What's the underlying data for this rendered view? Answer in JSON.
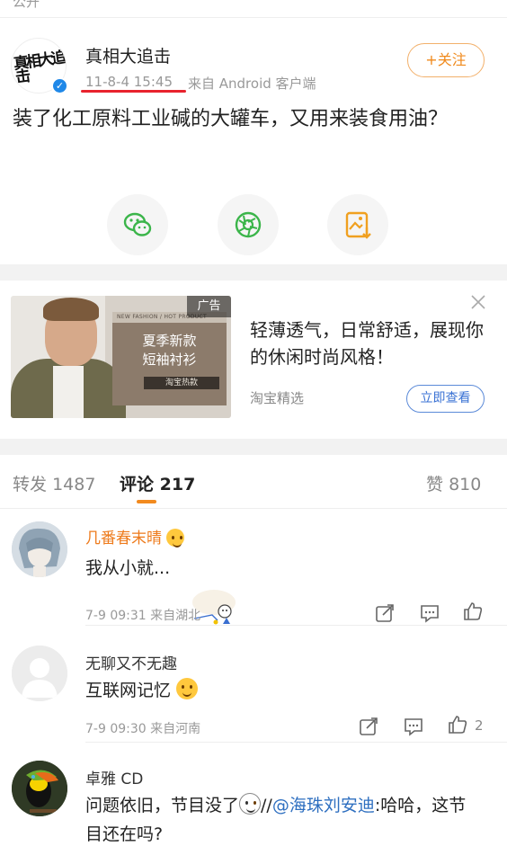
{
  "top_strip": {
    "text": "公开"
  },
  "post": {
    "author": "真相大追击",
    "avatar_logo": "真相大追击",
    "time": "11-8-4 15:45",
    "source": "来自 Android 客户端",
    "follow_label": "+关注",
    "text": "装了化工原料工业碱的大罐车，又用来装食用油？",
    "share_icons": [
      "wechat-icon",
      "moments-icon",
      "save-image-icon"
    ]
  },
  "ad": {
    "badge": "广告",
    "image_caption": "NEW FASHION / HOT PRODUCT",
    "image_title_1": "夏季新款",
    "image_title_2": "短袖衬衫",
    "image_tag": "淘宝热款",
    "text": "轻薄透气，日常舒适，展现你的休闲时尚风格！",
    "source": "淘宝精选",
    "button": "立即查看"
  },
  "tabs": {
    "repost_label": "转发",
    "repost_count": "1487",
    "comment_label": "评论",
    "comment_count": "217",
    "like_label": "赞",
    "like_count": "810"
  },
  "comments": [
    {
      "name": "几番春末晴",
      "text": "我从小就...",
      "meta": "7-9 09:31 来自湖北",
      "likes": ""
    },
    {
      "name": "无聊又不无趣",
      "text": "互联网记忆",
      "meta": "7-9 09:30 来自河南",
      "likes": "2"
    },
    {
      "name": "卓雅 CD",
      "text_prefix": "问题依旧，节目没了",
      "mention_sep": "//",
      "mention": "@海珠刘安迪",
      "text_suffix": ":哈哈，这节目还在吗?"
    }
  ],
  "colors": {
    "accent_orange": "#f08a1c",
    "underline_red": "#e8232d",
    "link_blue": "#2e6fc0",
    "name_orange": "#ee7b1c",
    "verify_blue": "#1f88e8"
  }
}
